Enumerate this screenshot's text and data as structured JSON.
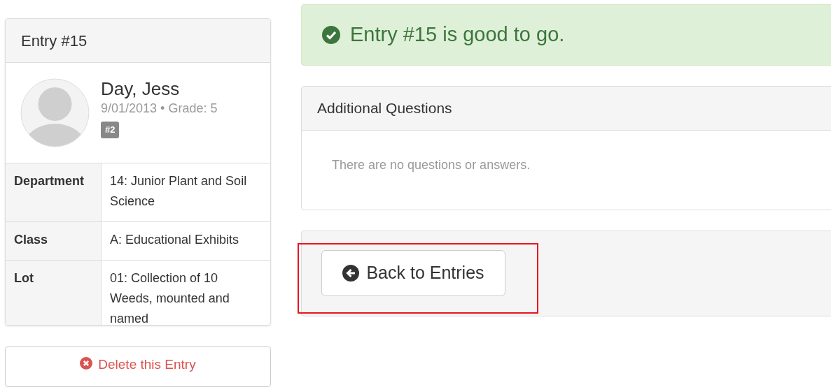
{
  "entry_card": {
    "title": "Entry #15",
    "person": {
      "name": "Day, Jess",
      "details": "9/01/2013 • Grade: 5",
      "badge": "#2"
    },
    "fields": [
      {
        "label": "Department",
        "value": "14: Junior Plant and Soil Science"
      },
      {
        "label": "Class",
        "value": "A: Educational Exhibits"
      },
      {
        "label": "Lot",
        "value": "01: Collection of 10 Weeds, mounted and named"
      }
    ]
  },
  "delete_button": {
    "label": "Delete this Entry"
  },
  "alert": {
    "message": "Entry #15 is good to go."
  },
  "questions_panel": {
    "title": "Additional Questions",
    "empty_text": "There are no questions or answers."
  },
  "back_button": {
    "label": "Back to Entries",
    "highlighted": true
  }
}
